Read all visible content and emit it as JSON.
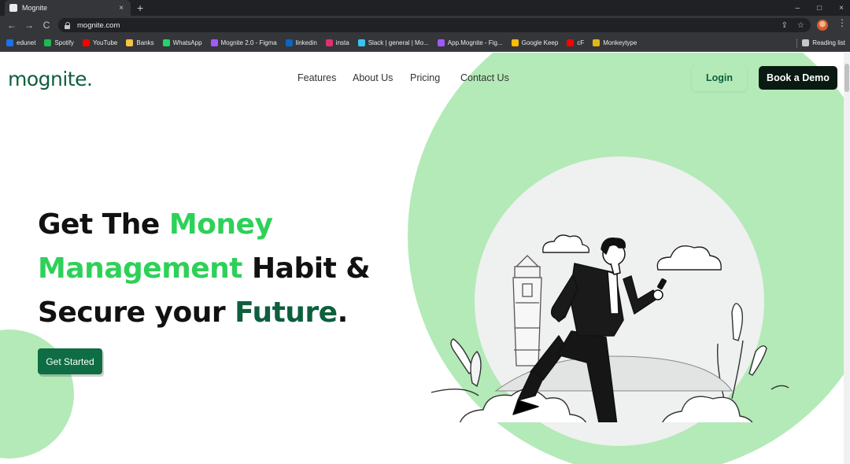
{
  "browser": {
    "tab_title": "Mognite",
    "tab_close": "×",
    "new_tab": "+",
    "window_controls": [
      "–",
      "□",
      "×"
    ],
    "nav": {
      "back": "←",
      "forward": "→",
      "reload": "C"
    },
    "url": "mognite.com",
    "omni_icons": [
      "⇪",
      "☆"
    ],
    "menu": "⋮",
    "bookmarks": [
      {
        "label": "edunet",
        "color": "#1a73e8"
      },
      {
        "label": "Spotify",
        "color": "#1db954"
      },
      {
        "label": "YouTube",
        "color": "#ff0000"
      },
      {
        "label": "Banks",
        "color": "#f6c342"
      },
      {
        "label": "WhatsApp",
        "color": "#25d366"
      },
      {
        "label": "Mognite 2.0 - Figma",
        "color": "#a259ff"
      },
      {
        "label": "linkedin",
        "color": "#0a66c2"
      },
      {
        "label": "insta",
        "color": "#e1306c"
      },
      {
        "label": "Slack | general | Mo...",
        "color": "#36c5f0"
      },
      {
        "label": "App.Mognite - Fig...",
        "color": "#a259ff"
      },
      {
        "label": "Google Keep",
        "color": "#fbbc04"
      },
      {
        "label": "cF",
        "color": "#ff0000"
      },
      {
        "label": "Monkeytype",
        "color": "#e2b714"
      }
    ],
    "reading_list": "Reading list"
  },
  "site": {
    "logo": "mognite.",
    "nav_links": [
      "Features",
      "About Us",
      "Pricing",
      "Contact Us"
    ],
    "login": "Login",
    "book_demo": "Book a Demo",
    "hero": {
      "line1": {
        "a": "Get The ",
        "b": "Money"
      },
      "line2": {
        "a": "Management",
        "b": " Habit &"
      },
      "line3": {
        "a": "Secure your ",
        "b": "Future",
        "c": "."
      }
    },
    "cta": "Get Started"
  },
  "colors": {
    "brand_dark_green": "#0e5f3d",
    "brand_bright_green": "#2ed158",
    "mint_bg": "#b3eab7",
    "button_dark": "#0a1a12"
  }
}
